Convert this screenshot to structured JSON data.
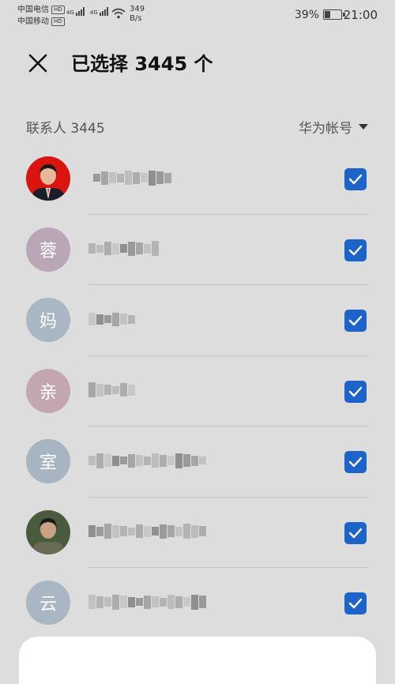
{
  "status_bar": {
    "carrier_1": "中国电信",
    "carrier_2": "中国移动",
    "hd_badge": "HD",
    "network_type": "4G",
    "speed_value": "349",
    "speed_unit": "B/s",
    "battery_percent": "39%",
    "battery_level": 0.39,
    "time": "21:00"
  },
  "header": {
    "title": "已选择 3445 个"
  },
  "section": {
    "label": "联系人 3445",
    "account_filter": "华为帐号"
  },
  "contacts": [
    {
      "avatar": "photo",
      "initial": "",
      "avatar_color": "#d8150f",
      "name_prefix": "",
      "selected": true
    },
    {
      "avatar": "letter",
      "initial": "蓉",
      "avatar_color": "#b9a7b8",
      "name_prefix": "",
      "selected": true
    },
    {
      "avatar": "letter",
      "initial": "妈",
      "avatar_color": "#a9b7c4",
      "name_prefix": "",
      "selected": true
    },
    {
      "avatar": "letter",
      "initial": "亲",
      "avatar_color": "#c4a7ae",
      "name_prefix": "",
      "selected": true
    },
    {
      "avatar": "letter",
      "initial": "室",
      "avatar_color": "#a7b4c2",
      "name_prefix": "",
      "selected": true
    },
    {
      "avatar": "photo",
      "initial": "",
      "avatar_color": "#4a5a3c",
      "name_prefix": "",
      "selected": true
    },
    {
      "avatar": "letter",
      "initial": "云",
      "avatar_color": "#a9b7c4",
      "name_prefix": "",
      "selected": true
    }
  ],
  "colors": {
    "background": "#dddddd",
    "accent": "#1e64c8",
    "divider": "#c4c4c4"
  }
}
